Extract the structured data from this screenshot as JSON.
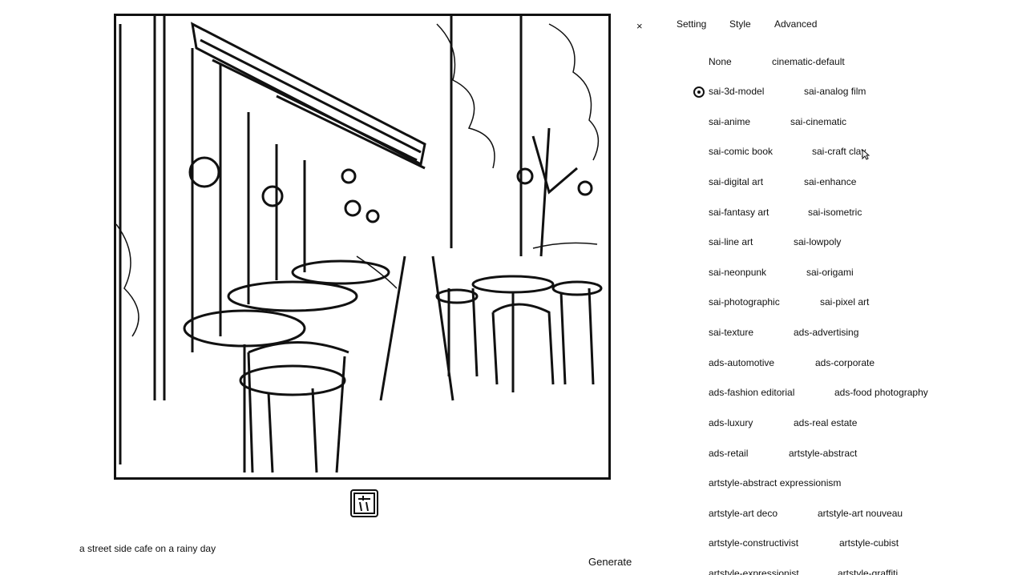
{
  "close_label": "×",
  "tabs": [
    "Setting",
    "Style",
    "Advanced"
  ],
  "styles": [
    [
      "None",
      "cinematic-default"
    ],
    [
      "sai-3d-model",
      "sai-analog film"
    ],
    [
      "sai-anime",
      "sai-cinematic"
    ],
    [
      "sai-comic book",
      "sai-craft clay"
    ],
    [
      "sai-digital art",
      "sai-enhance"
    ],
    [
      "sai-fantasy art",
      "sai-isometric"
    ],
    [
      "sai-line art",
      "sai-lowpoly"
    ],
    [
      "sai-neonpunk",
      "sai-origami"
    ],
    [
      "sai-photographic",
      "sai-pixel art"
    ],
    [
      "sai-texture",
      "ads-advertising"
    ],
    [
      "ads-automotive",
      "ads-corporate"
    ],
    [
      "ads-fashion editorial",
      "ads-food photography"
    ],
    [
      "ads-luxury",
      "ads-real estate"
    ],
    [
      "ads-retail",
      "artstyle-abstract"
    ],
    [
      "artstyle-abstract expressionism"
    ],
    [
      "artstyle-art deco",
      "artstyle-art nouveau"
    ],
    [
      "artstyle-constructivist",
      "artstyle-cubist"
    ],
    [
      "artstyle-expressionist",
      "artstyle-graffiti"
    ]
  ],
  "selected_style": "sai-3d-model",
  "prompt_text": "a street side cafe on a rainy day",
  "generate_label": "Generate",
  "icons": {
    "close": "close-icon",
    "thumbnail": "image-thumbnail-icon",
    "radio": "radio-selected-icon",
    "cursor": "mouse-pointer-icon"
  }
}
